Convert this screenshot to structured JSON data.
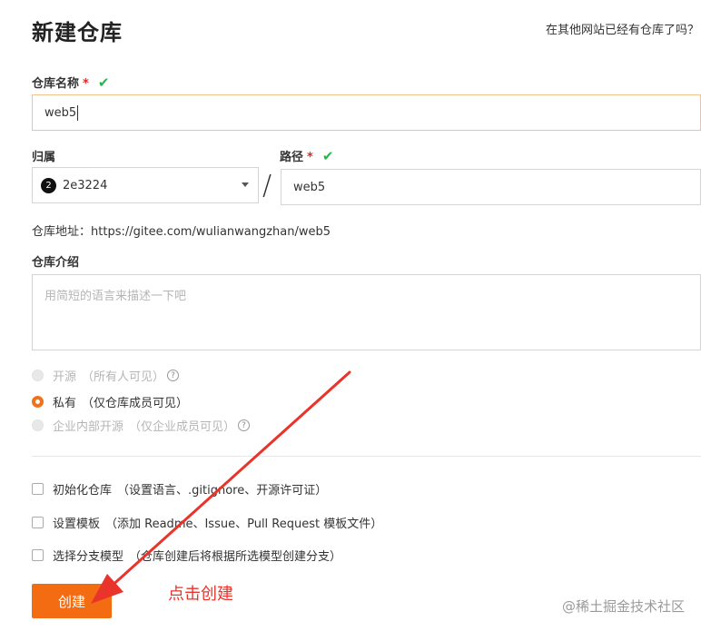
{
  "page": {
    "title": "新建仓库",
    "import_link": "在其他网站已经有仓库了吗？"
  },
  "form": {
    "name_label": "仓库名称",
    "required_mark": "*",
    "valid_mark": "✔",
    "name_value": "web5",
    "owner_label": "归属",
    "owner_avatar": "2",
    "owner_value": "2e3224",
    "path_separator": "/",
    "path_label": "路径",
    "path_value": "web5",
    "address_label": "仓库地址：",
    "address_value": "https://gitee.com/wulianwangzhan/web5",
    "desc_label": "仓库介绍",
    "desc_placeholder": "用简短的语言来描述一下吧",
    "visibility": [
      {
        "label": "开源",
        "hint": "（所有人可见）",
        "selected": false,
        "disabled": true
      },
      {
        "label": "私有",
        "hint": "（仅仓库成员可见）",
        "selected": true,
        "disabled": false
      },
      {
        "label": "企业内部开源",
        "hint": "（仅企业成员可见）",
        "selected": false,
        "disabled": true
      }
    ],
    "options": [
      {
        "label": "初始化仓库",
        "hint": "（设置语言、.gitignore、开源许可证）",
        "checked": false
      },
      {
        "label": "设置模板",
        "hint": "（添加 Readme、Issue、Pull Request 模板文件）",
        "checked": false
      },
      {
        "label": "选择分支模型",
        "hint": "（仓库创建后将根据所选模型创建分支）",
        "checked": false
      }
    ],
    "create_button": "创建"
  },
  "annotation": {
    "text": "点击创建",
    "color": "#e8342a"
  },
  "watermark": "@稀土掘金技术社区",
  "colors": {
    "accent": "#f36c12",
    "valid": "#21ba45",
    "required": "#db2828"
  }
}
